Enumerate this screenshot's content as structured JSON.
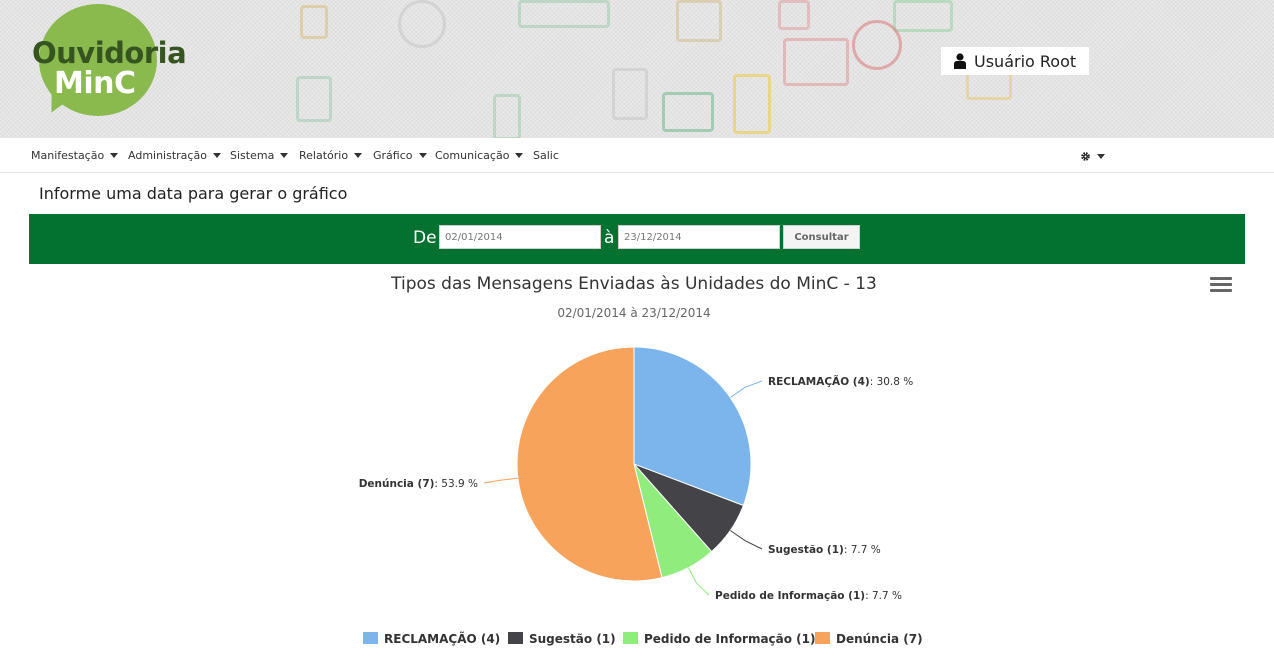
{
  "header": {
    "logo": {
      "line1": "Ouvidoria",
      "line2": "MinC"
    },
    "user_label": "Usuário Root",
    "icons": {
      "user": "user-icon"
    }
  },
  "nav": {
    "items": [
      {
        "label": "Manifestação",
        "dropdown": true
      },
      {
        "label": "Administração",
        "dropdown": true
      },
      {
        "label": "Sistema",
        "dropdown": true
      },
      {
        "label": "Relatório",
        "dropdown": true
      },
      {
        "label": "Gráfico",
        "dropdown": true
      },
      {
        "label": "Comunicação",
        "dropdown": true
      },
      {
        "label": "Salic",
        "dropdown": false
      }
    ],
    "settings_icon": "gear-icon"
  },
  "form": {
    "title": "Informe uma data para gerar o gráfico",
    "from_label": "De",
    "from_value": "02/01/2014",
    "to_label": "à",
    "to_value": "23/12/2014",
    "submit_label": "Consultar"
  },
  "colors": {
    "brand_green": "#037230",
    "logo_green": "#8ab94e",
    "logo_dark": "#35541f"
  },
  "chart_data": {
    "type": "pie",
    "title": "Tipos das Mensagens Enviadas às Unidades do MinC - 13",
    "subtitle": "02/01/2014 à 23/12/2014",
    "menu_icon": "hamburger-menu-icon",
    "slices": [
      {
        "name": "RECLAMAÇÃO",
        "count": 4,
        "percent": 30.8,
        "label_name": "RECLAMAÇÃO (4)",
        "label_value": ": 30.8 %",
        "legend": "RECLAMAÇÃO (4)",
        "color": "#7cb5ec"
      },
      {
        "name": "Sugestão",
        "count": 1,
        "percent": 7.7,
        "label_name": "Sugestão (1)",
        "label_value": ": 7.7 %",
        "legend": "Sugestão (1)",
        "color": "#434348"
      },
      {
        "name": "Pedido de Informação",
        "count": 1,
        "percent": 7.7,
        "label_name": "Pedido de Informação (1)",
        "label_value": ": 7.7 %",
        "legend": "Pedido de Informação (1)",
        "color": "#90ed7d"
      },
      {
        "name": "Denúncia",
        "count": 7,
        "percent": 53.9,
        "label_name": "Denúncia (7)",
        "label_value": ": 53.9 %",
        "legend": "Denúncia (7)",
        "color": "#f7a35c"
      }
    ],
    "legend_position": "bottom"
  }
}
